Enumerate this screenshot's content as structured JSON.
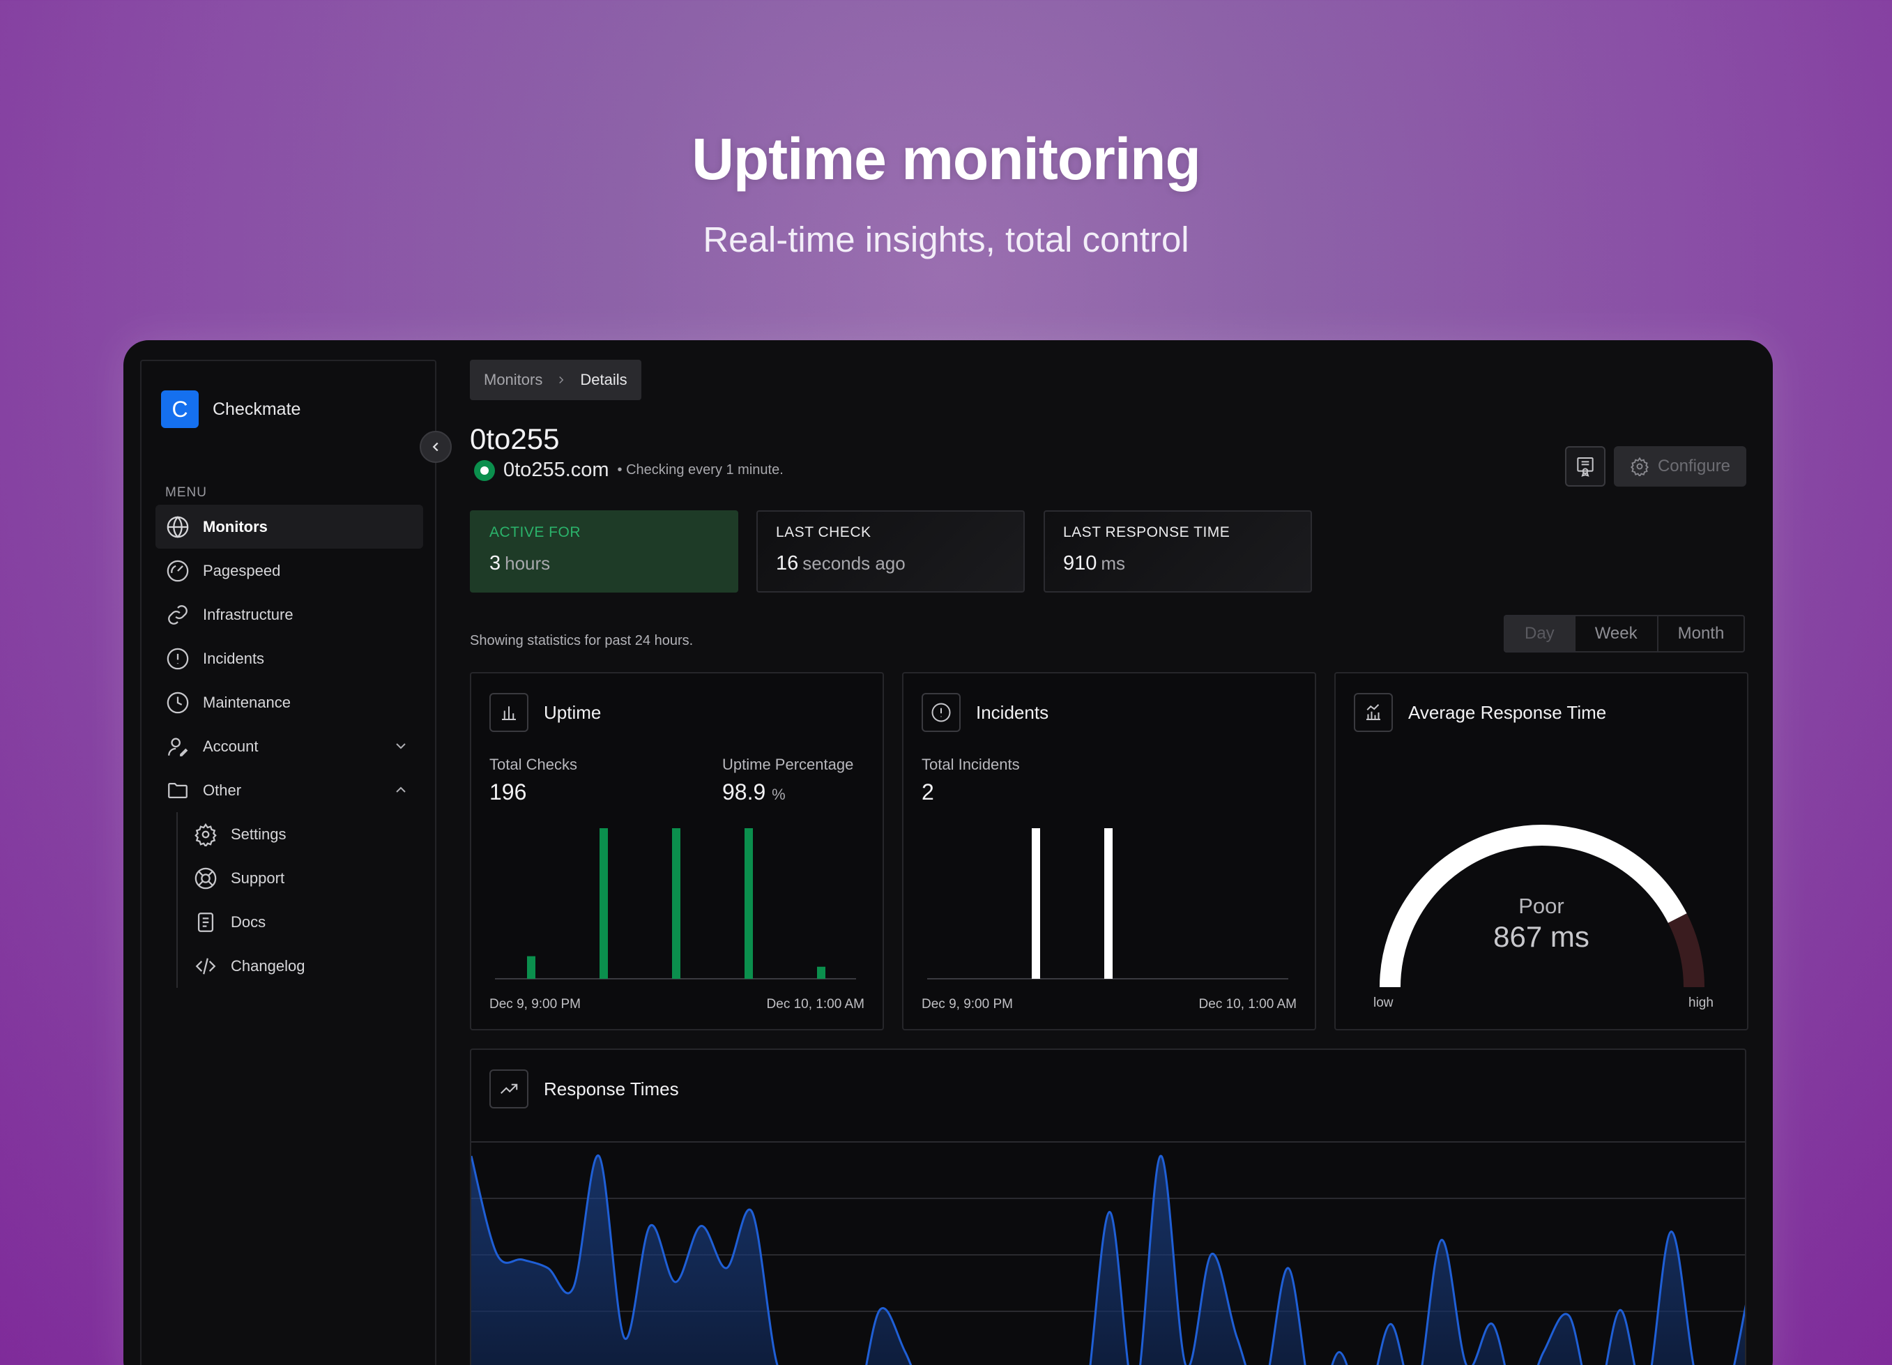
{
  "hero": {
    "title": "Uptime monitoring",
    "subtitle": "Real-time insights, total control"
  },
  "sidebar": {
    "brand_initial": "C",
    "brand_name": "Checkmate",
    "menu_label": "MENU",
    "items": [
      {
        "label": "Monitors",
        "icon": "globe-icon",
        "active": true
      },
      {
        "label": "Pagespeed",
        "icon": "gauge-icon"
      },
      {
        "label": "Infrastructure",
        "icon": "link-icon"
      },
      {
        "label": "Incidents",
        "icon": "alert-circle-icon"
      },
      {
        "label": "Maintenance",
        "icon": "clock-icon"
      },
      {
        "label": "Account",
        "icon": "user-icon",
        "expandable": "collapsed"
      },
      {
        "label": "Other",
        "icon": "folder-icon",
        "expandable": "expanded"
      }
    ],
    "sub_items": [
      {
        "label": "Settings",
        "icon": "gear-icon"
      },
      {
        "label": "Support",
        "icon": "lifebuoy-icon"
      },
      {
        "label": "Docs",
        "icon": "document-icon"
      },
      {
        "label": "Changelog",
        "icon": "code-icon"
      }
    ]
  },
  "breadcrumb": {
    "parent": "Monitors",
    "current": "Details"
  },
  "monitor": {
    "name": "0to255",
    "url": "0to255.com",
    "interval": "• Checking every 1 minute.",
    "status_color": "#0b8f4d"
  },
  "actions": {
    "configure_label": "Configure"
  },
  "stats": {
    "active_for": {
      "label": "ACTIVE FOR",
      "value": "3",
      "unit": "hours"
    },
    "last_check": {
      "label": "LAST CHECK",
      "value": "16",
      "unit": "seconds ago"
    },
    "last_response": {
      "label": "LAST RESPONSE TIME",
      "value": "910",
      "unit": "ms"
    }
  },
  "range": {
    "showing_text": "Showing statistics for past 24 hours.",
    "options": [
      "Day",
      "Week",
      "Month"
    ],
    "selected": "Day"
  },
  "uptime_panel": {
    "title": "Uptime",
    "total_checks_label": "Total Checks",
    "total_checks": "196",
    "percentage_label": "Uptime Percentage",
    "percentage": "98.9",
    "percentage_unit": "%",
    "x_start": "Dec 9, 9:00 PM",
    "x_end": "Dec 10, 1:00 AM"
  },
  "incidents_panel": {
    "title": "Incidents",
    "total_label": "Total Incidents",
    "total": "2",
    "x_start": "Dec 9, 9:00 PM",
    "x_end": "Dec 10, 1:00 AM"
  },
  "response_panel": {
    "title": "Average Response Time",
    "rating": "Poor",
    "value": "867 ms",
    "low_label": "low",
    "high_label": "high",
    "gauge_fraction": 0.85
  },
  "response_times_panel": {
    "title": "Response Times"
  },
  "chart_data": [
    {
      "type": "bar",
      "title": "Uptime",
      "x": [
        "Dec 9, 9:00 PM",
        "",
        "",
        "",
        "Dec 10, 1:00 AM"
      ],
      "values": [
        0.15,
        1.0,
        1.0,
        1.0,
        0.08
      ],
      "color": "#0b8f4d"
    },
    {
      "type": "bar",
      "title": "Incidents",
      "x": [
        "Dec 9, 9:00 PM",
        "",
        "",
        "",
        "Dec 10, 1:00 AM"
      ],
      "values": [
        0,
        1.0,
        1.0,
        0,
        0
      ],
      "color": "#ffffff"
    },
    {
      "type": "area",
      "title": "Response Times",
      "values": [
        0.95,
        0.6,
        0.58,
        0.55,
        0.48,
        0.95,
        0.3,
        0.7,
        0.5,
        0.7,
        0.55,
        0.75,
        0.2,
        0.15,
        0.08,
        0.02,
        0.4,
        0.25,
        0.05,
        0.12,
        0.1,
        0.08,
        0.15,
        0.1,
        0.05,
        0.75,
        0.1,
        0.95,
        0.2,
        0.6,
        0.3,
        0.1,
        0.55,
        0.05,
        0.25,
        0.05,
        0.35,
        0.1,
        0.65,
        0.2,
        0.35,
        0.05,
        0.25,
        0.38,
        0.05,
        0.4,
        0.1,
        0.68,
        0.15,
        0.05,
        0.45
      ],
      "color": "#1f5fd6"
    }
  ]
}
